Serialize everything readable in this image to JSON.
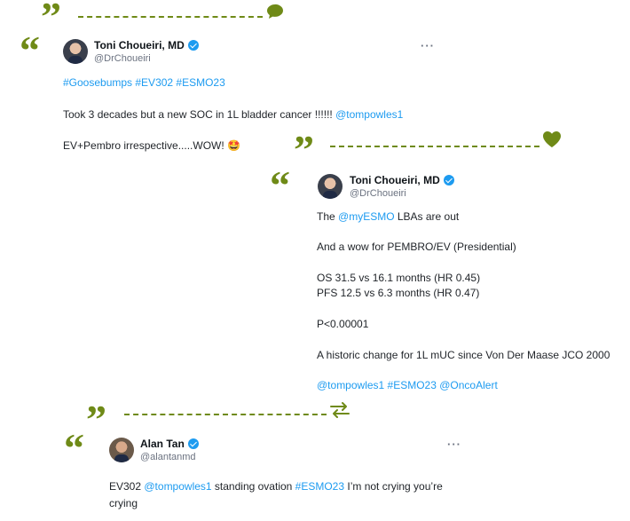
{
  "tweets": [
    {
      "name": "Toni Choueiri, MD",
      "handle": "@DrChoueiri",
      "more": "···",
      "icon": "speech-bubble-icon",
      "lines": [
        {
          "parts": [
            {
              "t": "#Goosebumps #EV302 #ESMO23",
              "link": true
            }
          ]
        },
        {
          "parts": [
            {
              "t": "Took 3 decades but a new SOC in 1L bladder cancer !!!!!! ",
              "link": false
            },
            {
              "t": "@tompowles1",
              "link": true
            }
          ]
        },
        {
          "parts": [
            {
              "t": "EV+Pembro irrespective.....WOW! 🤩",
              "link": false
            }
          ]
        }
      ]
    },
    {
      "name": "Toni Choueiri, MD",
      "handle": "@DrChoueiri",
      "icon": "heart-icon",
      "lines": [
        {
          "parts": [
            {
              "t": "The ",
              "link": false
            },
            {
              "t": "@myESMO",
              "link": true
            },
            {
              "t": " LBAs are out",
              "link": false
            }
          ]
        },
        {
          "parts": [
            {
              "t": "And a wow for PEMBRO/EV (Presidential)",
              "link": false
            }
          ]
        },
        {
          "parts": [
            {
              "t": "OS 31.5 vs 16.1 months (HR 0.45)",
              "link": false
            }
          ]
        },
        {
          "parts": [
            {
              "t": "PFS 12.5 vs 6.3 months (HR 0.47)",
              "link": false
            }
          ]
        },
        {
          "parts": [
            {
              "t": "P<0.00001",
              "link": false
            }
          ]
        },
        {
          "parts": [
            {
              "t": "A historic change for 1L mUC since Von Der Maase JCO 2000",
              "link": false
            }
          ]
        },
        {
          "parts": [
            {
              "t": "@tompowles1 #ESMO23 @OncoAlert",
              "link": true
            }
          ]
        }
      ]
    },
    {
      "name": "Alan Tan",
      "handle": "@alantanmd",
      "more": "···",
      "icon": "retweet-icon",
      "lines": [
        {
          "parts": [
            {
              "t": "EV302 ",
              "link": false
            },
            {
              "t": "@tompowles1",
              "link": true
            },
            {
              "t": " standing ovation ",
              "link": false
            },
            {
              "t": "#ESMO23",
              "link": true
            },
            {
              "t": " I’m not crying you’re",
              "link": false
            }
          ]
        },
        {
          "parts": [
            {
              "t": "crying",
              "link": false
            }
          ]
        }
      ]
    }
  ],
  "colors": {
    "accent": "#6f8a17",
    "link": "#1d9bf0"
  }
}
